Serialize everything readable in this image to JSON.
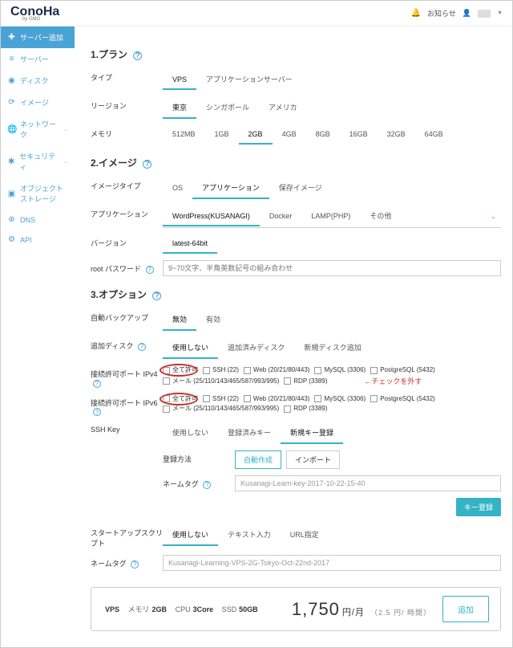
{
  "notify_label": "お知らせ",
  "sidebar": {
    "items": [
      {
        "label": "サーバー追加"
      },
      {
        "label": "サーバー"
      },
      {
        "label": "ディスク"
      },
      {
        "label": "イメージ"
      },
      {
        "label": "ネットワーク"
      },
      {
        "label": "セキュリティ"
      },
      {
        "label": "オブジェクト\nストレージ"
      },
      {
        "label": "DNS"
      },
      {
        "label": "API"
      }
    ]
  },
  "section1": {
    "title": "1.プラン"
  },
  "type_label": "タイプ",
  "type_opts": [
    "VPS",
    "アプリケーションサーバー"
  ],
  "region_label": "リージョン",
  "region_opts": [
    "東京",
    "シンガポール",
    "アメリカ"
  ],
  "memory_label": "メモリ",
  "memory_opts": [
    "512MB",
    "1GB",
    "2GB",
    "4GB",
    "8GB",
    "16GB",
    "32GB",
    "64GB"
  ],
  "section2": {
    "title": "2.イメージ"
  },
  "imgtype_label": "イメージタイプ",
  "imgtype_opts": [
    "OS",
    "アプリケーション",
    "保存イメージ"
  ],
  "app_label": "アプリケーション",
  "app_opts": [
    "WordPress(KUSANAGI)",
    "Docker",
    "LAMP(PHP)",
    "その他"
  ],
  "ver_label": "バージョン",
  "ver_opts": [
    "latest-64bit"
  ],
  "rootpw_label": "root パスワード",
  "rootpw_placeholder": "9~70文字、半角英数記号の組み合わせ",
  "section3": {
    "title": "3.オプション"
  },
  "backup_label": "自動バックアップ",
  "backup_opts": [
    "無効",
    "有効"
  ],
  "disk_label": "追加ディスク",
  "disk_opts": [
    "使用しない",
    "追加済みディスク",
    "新規ディスク追加"
  ],
  "port4_label": "接続許可ポート IPv4",
  "port6_label": "接続許可ポート IPv6",
  "port_opts_line1": [
    "全て許可",
    "SSH (22)",
    "Web (20/21/80/443)",
    "MySQL (3306)",
    "PostgreSQL (5432)"
  ],
  "port_opts_line2": [
    "メール (25/110/143/465/587/993/995)",
    "RDP (3389)"
  ],
  "annot": "←チェックを外す",
  "sshkey_label": "SSH Key",
  "sshkey_opts": [
    "使用しない",
    "登録済みキー",
    "新規キー登録"
  ],
  "regmethod_label": "登録方法",
  "regmethod_opts": [
    "自動作成",
    "インポート"
  ],
  "nametag_label": "ネームタグ",
  "nametag_val": "Kusanagi-Learn-key-2017-10-22-15-40",
  "keyreg_btn": "キー登録",
  "startup_label": "スタートアップスクリプト",
  "startup_opts": [
    "使用しない",
    "テキスト入力",
    "URL指定"
  ],
  "nametag2_val": "Kusanagi-Learning-VPS-2G-Tokyo-Oct-22nd-2017",
  "price": {
    "spec_vps": "VPS",
    "spec_mem_l": "メモリ",
    "spec_mem_v": "2GB",
    "spec_cpu_l": "CPU",
    "spec_cpu_v": "3Core",
    "spec_ssd_l": "SSD",
    "spec_ssd_v": "50GB",
    "amount": "1,750",
    "unit": "円/月",
    "sub": "（2.5 円/ 時間）",
    "add": "追加"
  }
}
